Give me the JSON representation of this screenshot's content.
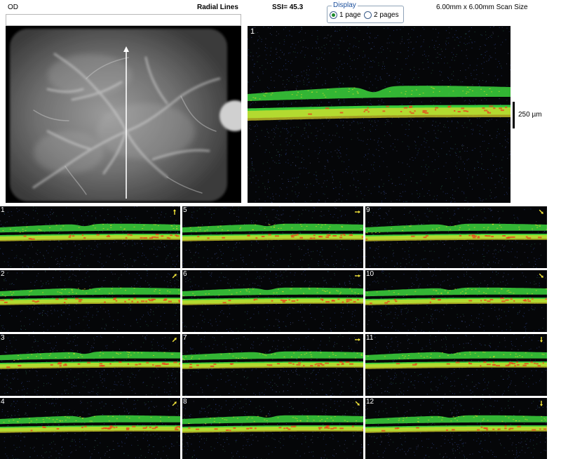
{
  "header": {
    "eye": "OD",
    "protocol": "Radial Lines",
    "ssi": "SSI= 45.3",
    "scan_size": "6.00mm x 6.00mm Scan Size"
  },
  "display": {
    "legend": "Display",
    "options": [
      {
        "label": "1 page",
        "selected": true
      },
      {
        "label": "2 pages",
        "selected": false
      }
    ]
  },
  "main_scan": {
    "number": "1",
    "scale_label": "250 µm"
  },
  "thumbnails": [
    {
      "number": "1",
      "arrow": "up"
    },
    {
      "number": "2",
      "arrow": "up-right"
    },
    {
      "number": "3",
      "arrow": "up-right"
    },
    {
      "number": "4",
      "arrow": "up-right"
    },
    {
      "number": "5",
      "arrow": "right"
    },
    {
      "number": "6",
      "arrow": "right"
    },
    {
      "number": "7",
      "arrow": "right"
    },
    {
      "number": "8",
      "arrow": "down-right"
    },
    {
      "number": "9",
      "arrow": "down-right"
    },
    {
      "number": "10",
      "arrow": "down-right"
    },
    {
      "number": "11",
      "arrow": "down"
    },
    {
      "number": "12",
      "arrow": "down"
    }
  ],
  "colors": {
    "retina_green": "#39c93a",
    "retina_yellow": "#e7e12c",
    "retina_red": "#e64a1e",
    "noise_blue": "#3b56b5",
    "arrow_yellow": "#f2e43a"
  }
}
